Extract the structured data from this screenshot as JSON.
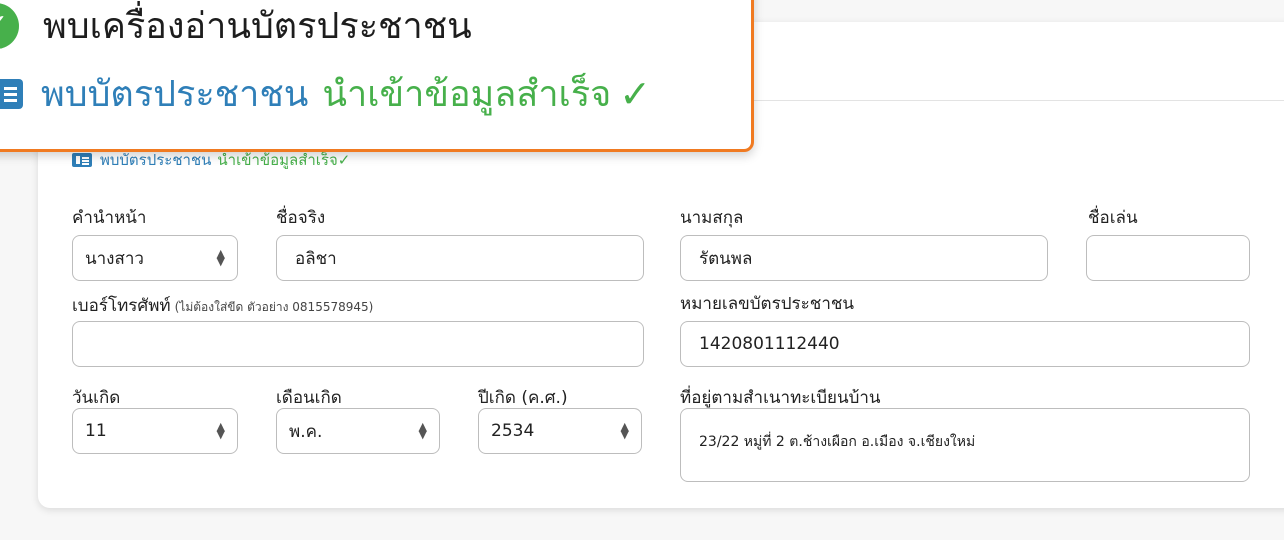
{
  "callout": {
    "reader_found": "พบเครื่องอ่านบัตรประชาชน",
    "card_found": "พบบัตรประชาชน",
    "import_success": "นำเข้าข้อมูลสำเร็จ",
    "check_glyph": "✓"
  },
  "notice": {
    "card_found": "พบบัตรประชาชน",
    "import_success": "นำเข้าข้อมูลสำเร็จ",
    "check_glyph": "✓"
  },
  "form": {
    "title": {
      "label": "คำนำหน้า",
      "value": "นางสาว"
    },
    "first_name": {
      "label": "ชื่อจริง",
      "value": "อลิชา"
    },
    "last_name": {
      "label": "นามสกุล",
      "value": "รัตนพล"
    },
    "nickname": {
      "label": "ชื่อเล่น",
      "value": ""
    },
    "phone": {
      "label": "เบอร์โทรศัพท์",
      "hint": "(ไม่ต้องใส่ขีด ตัวอย่าง 0815578945)",
      "value": ""
    },
    "id_number": {
      "label": "หมายเลขบัตรประชาชน",
      "value": "1420801112440"
    },
    "birth_day": {
      "label": "วันเกิด",
      "value": "11"
    },
    "birth_month": {
      "label": "เดือนเกิด",
      "value": "พ.ค."
    },
    "birth_year": {
      "label": "ปีเกิด (ค.ศ.)",
      "value": "2534"
    },
    "address": {
      "label": "ที่อยู่ตามสำเนาทะเบียนบ้าน",
      "value": "23/22 หมู่ที่ 2 ต.ช้างเผือก อ.เมือง จ.เชียงใหม่"
    }
  },
  "colors": {
    "accent_orange": "#f07a21",
    "success_green": "#47b04b",
    "info_blue": "#2f7fb8"
  },
  "icons": [
    "check-circle-icon",
    "id-card-icon",
    "checkmark-icon",
    "select-arrows-icon"
  ]
}
